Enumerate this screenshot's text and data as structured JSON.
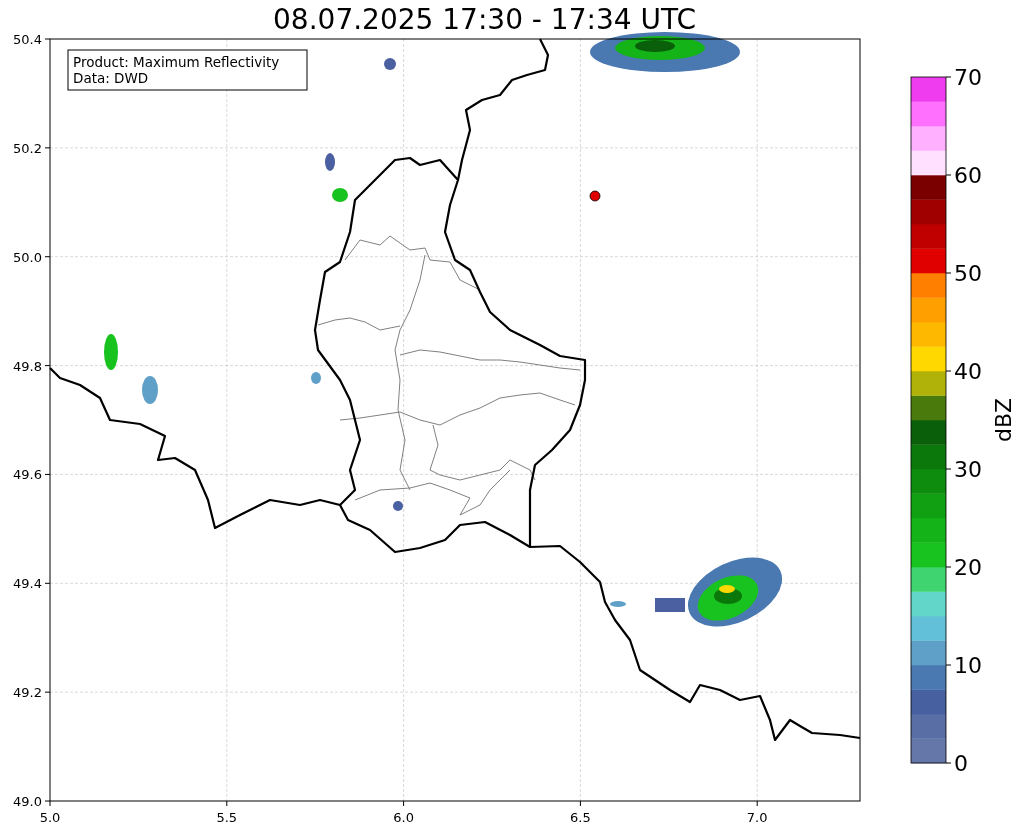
{
  "title": "08.07.2025 17:30 - 17:34 UTC",
  "legend": [
    "Product: Maximum Reflectivity",
    "Data: DWD"
  ],
  "y_axis": {
    "ticks": [
      "50.4",
      "50.2",
      "50.0",
      "49.8",
      "49.6",
      "49.4",
      "49.2",
      "49.0"
    ]
  },
  "x_axis": {
    "ticks": [
      "5.0",
      "5.5",
      "6.0",
      "6.5",
      "7.0"
    ]
  },
  "colorbar": {
    "label": "dBZ",
    "ticks": [
      "70",
      "60",
      "50",
      "40",
      "30",
      "20",
      "10",
      "0"
    ],
    "bands": [
      {
        "color": "#6477a8"
      },
      {
        "color": "#5a6ea6"
      },
      {
        "color": "#4660a0"
      },
      {
        "color": "#4a78b0"
      },
      {
        "color": "#5fa0c8"
      },
      {
        "color": "#62c0d8"
      },
      {
        "color": "#62d6c8"
      },
      {
        "color": "#3fd470"
      },
      {
        "color": "#19c31f"
      },
      {
        "color": "#14b418"
      },
      {
        "color": "#11a011"
      },
      {
        "color": "#0e8c0e"
      },
      {
        "color": "#0b780b"
      },
      {
        "color": "#0a5f0a"
      },
      {
        "color": "#4a7a0c"
      },
      {
        "color": "#b0b20a"
      },
      {
        "color": "#ffd800"
      },
      {
        "color": "#ffb800"
      },
      {
        "color": "#ffa000"
      },
      {
        "color": "#ff8000"
      },
      {
        "color": "#e00000"
      },
      {
        "color": "#c00000"
      },
      {
        "color": "#a00000"
      },
      {
        "color": "#7a0000"
      },
      {
        "color": "#ffe0ff"
      },
      {
        "color": "#ffb0ff"
      },
      {
        "color": "#ff70ff"
      },
      {
        "color": "#ee3cee"
      }
    ]
  }
}
